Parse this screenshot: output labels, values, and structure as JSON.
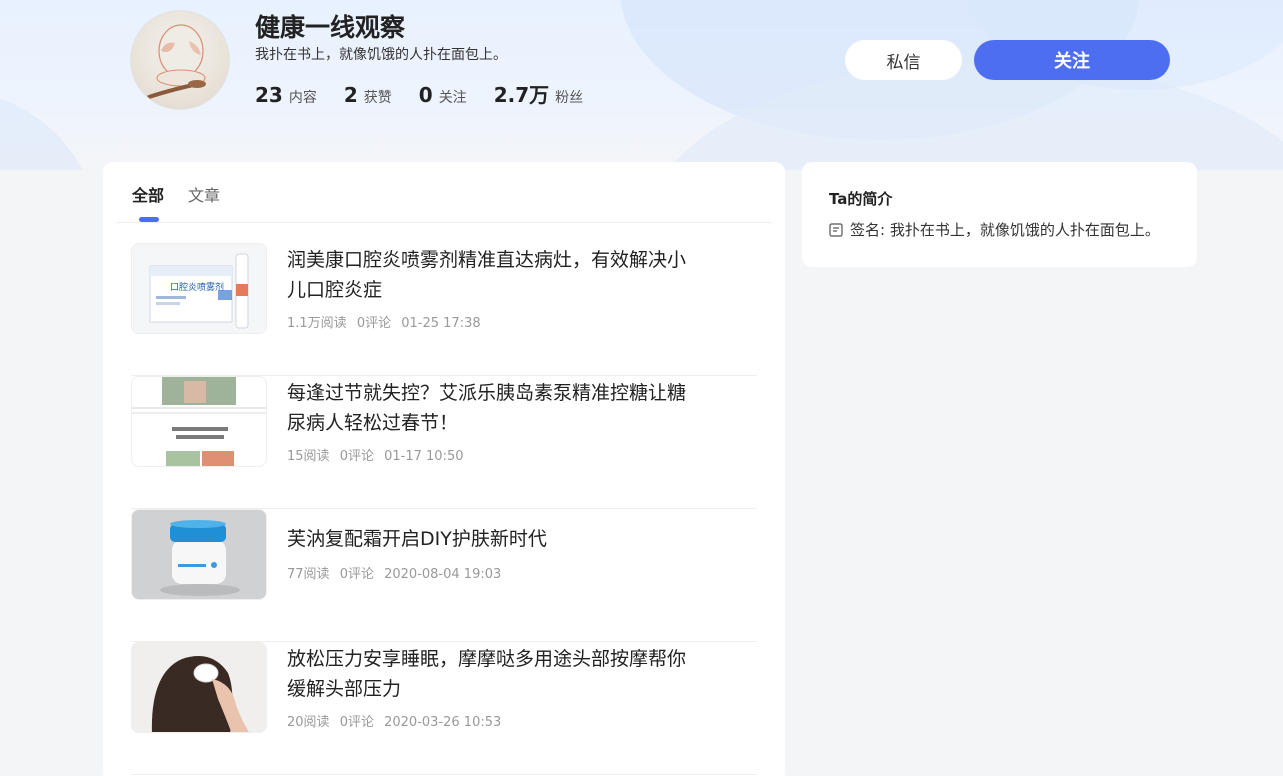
{
  "profile": {
    "name": "健康一线观察",
    "signature": "我扑在书上，就像饥饿的人扑在面包上。",
    "stats": [
      {
        "num": "23",
        "label": "内容"
      },
      {
        "num": "2",
        "label": "获赞"
      },
      {
        "num": "0",
        "label": "关注"
      },
      {
        "num": "2.7万",
        "label": "粉丝"
      }
    ]
  },
  "actions": {
    "message_label": "私信",
    "follow_label": "关注"
  },
  "tabs": [
    {
      "label": "全部",
      "active": true
    },
    {
      "label": "文章",
      "active": false
    }
  ],
  "feed": [
    {
      "title": "润美康口腔炎喷雾剂精准直达病灶，有效解决小儿口腔炎症",
      "reads": "1.1万阅读",
      "comments": "0评论",
      "time": "01-25 17:38",
      "thumb_text": "口腔炎喷雾剂"
    },
    {
      "title": "每逢过节就失控？艾派乐胰岛素泵精准控糖让糖尿病人轻松过春节！",
      "reads": "15阅读",
      "comments": "0评论",
      "time": "01-17 10:50"
    },
    {
      "title": "芙汭复配霜开启DIY护肤新时代",
      "reads": "77阅读",
      "comments": "0评论",
      "time": "2020-08-04 19:03"
    },
    {
      "title": "放松压力安享睡眠，摩摩哒多用途头部按摩帮你缓解头部压力",
      "reads": "20阅读",
      "comments": "0评论",
      "time": "2020-03-26 10:53"
    }
  ],
  "sidebar": {
    "title": "Ta的简介",
    "signature_row": "签名: 我扑在书上，就像饥饿的人扑在面包上。"
  },
  "colors": {
    "accent": "#4e6ef2",
    "page_bg": "#f4f5f7"
  },
  "icons": {
    "signature": "note-icon"
  }
}
